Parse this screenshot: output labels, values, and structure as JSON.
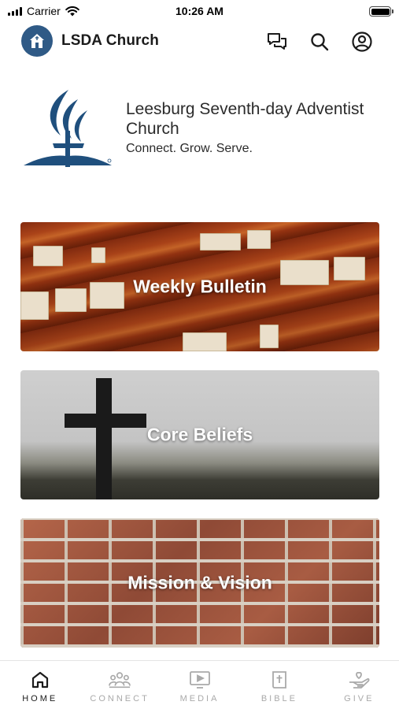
{
  "status_bar": {
    "carrier": "Carrier",
    "time": "10:26 AM"
  },
  "header": {
    "title": "LSDA Church",
    "icons": [
      "chat-icon",
      "search-icon",
      "profile-icon"
    ]
  },
  "church": {
    "name": "Leesburg Seventh-day Adventist Church",
    "tagline": "Connect. Grow. Serve.",
    "logo_color": "#1f4f7d"
  },
  "cards": [
    {
      "title": "Weekly Bulletin"
    },
    {
      "title": "Core Beliefs"
    },
    {
      "title": "Mission & Vision"
    }
  ],
  "tabs": [
    {
      "label": "HOME",
      "icon": "home-icon",
      "active": true
    },
    {
      "label": "CONNECT",
      "icon": "people-icon",
      "active": false
    },
    {
      "label": "MEDIA",
      "icon": "video-icon",
      "active": false
    },
    {
      "label": "BIBLE",
      "icon": "bible-icon",
      "active": false
    },
    {
      "label": "GIVE",
      "icon": "give-icon",
      "active": false
    }
  ],
  "colors": {
    "accent": "#2f5a86",
    "active_tab": "#1b1b1b",
    "inactive_tab": "#a9a9a9"
  }
}
